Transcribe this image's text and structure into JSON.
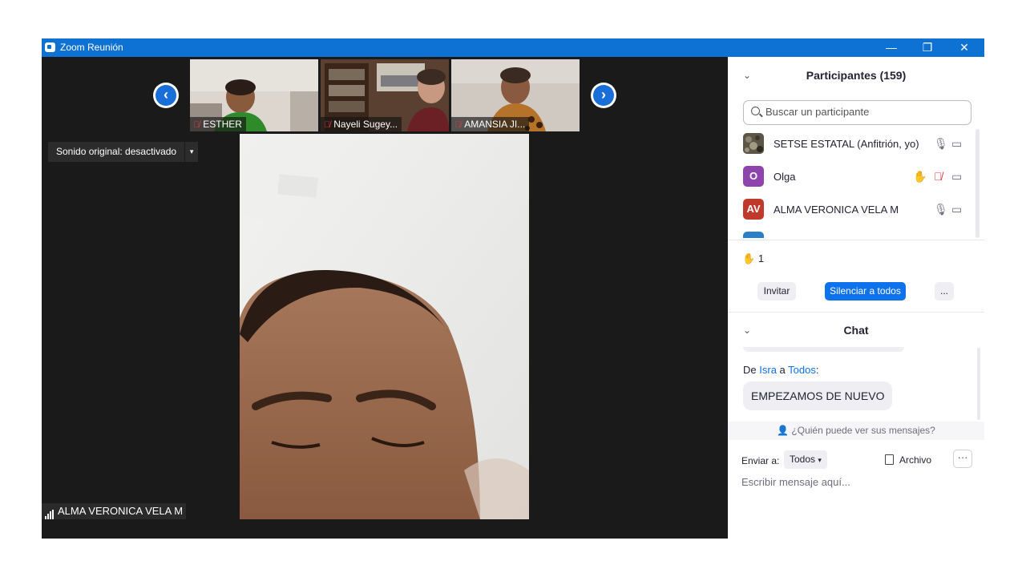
{
  "window": {
    "title": "Zoom Reunión",
    "controls": {
      "minimize": "—",
      "restore": "❐",
      "close": "✕"
    }
  },
  "colors": {
    "titlebar": "#0e71d4",
    "accent": "#0e72ed",
    "muted_mic": "#e0383e",
    "avatar_olga": "#8e44ad",
    "avatar_av": "#c0392b"
  },
  "gallery": {
    "prev_arrow": "‹",
    "next_arrow": "›",
    "thumbnails": [
      {
        "name": "ESTHER",
        "mic_icon": "muted-mic-icon"
      },
      {
        "name": "Nayeli Sugey...",
        "mic_icon": "muted-mic-icon"
      },
      {
        "name": "AMANSIA JI...",
        "mic_icon": "muted-mic-icon"
      }
    ]
  },
  "sound_button": {
    "label": "Sonido original: desactivado",
    "dropdown": "▾"
  },
  "active_speaker": {
    "name": "ALMA VERONICA VELA M"
  },
  "participants": {
    "title": "Participantes (159)",
    "search_placeholder": "Buscar un participante",
    "list": [
      {
        "name": "SETSE ESTATAL (Anfitrión, yo)",
        "avatar": "",
        "mic": "mic-icon",
        "video": "video-icon"
      },
      {
        "name": "Olga",
        "avatar": "O",
        "hand": "✋",
        "mic": "muted-mic-icon",
        "video": "video-icon"
      },
      {
        "name": "ALMA VERONICA VELA M",
        "avatar": "AV",
        "mic": "mic-icon",
        "video": "video-icon"
      }
    ],
    "raised_hands": {
      "icon": "✋",
      "count": "1"
    },
    "buttons": {
      "invite": "Invitar",
      "mute_all": "Silenciar a todos",
      "more": "..."
    }
  },
  "chat": {
    "title": "Chat",
    "message": {
      "prefix": "De",
      "sender": "Isra",
      "connector": "a",
      "recipient": "Todos",
      "suffix": ":",
      "text": "EMPEZAMOS DE NUEVO"
    },
    "privacy_text": "¿Quién puede ver sus mensajes?",
    "send_to_label": "Enviar a:",
    "send_to_value": "Todos",
    "file_label": "Archivo",
    "more_label": "···",
    "compose_placeholder": "Escribir mensaje aquí..."
  }
}
